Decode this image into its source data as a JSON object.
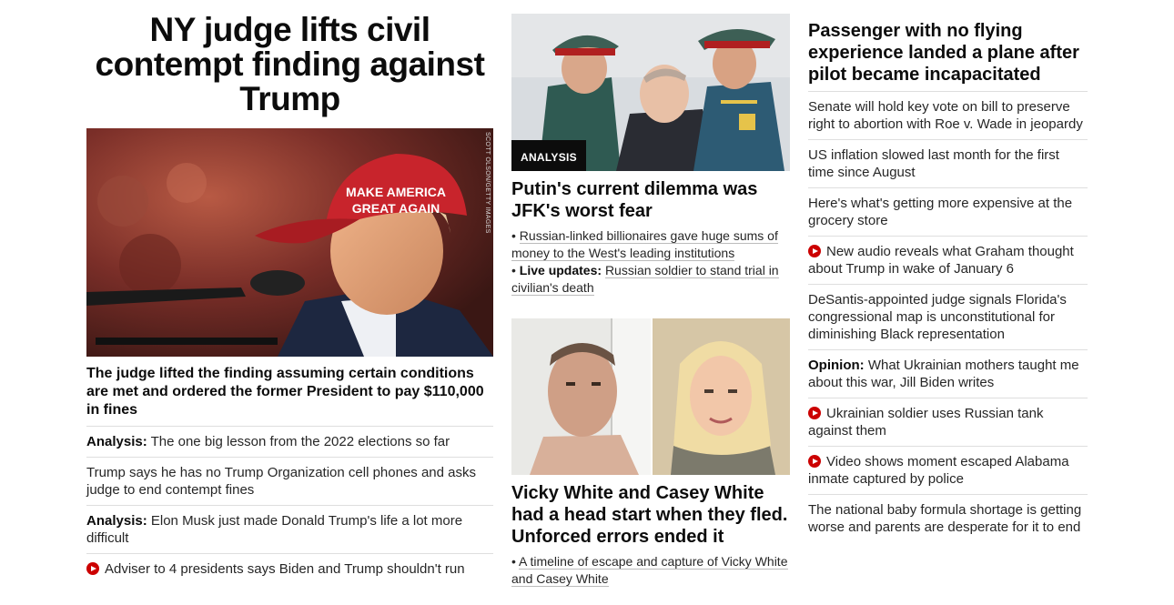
{
  "col1": {
    "headline": "NY judge lifts civil contempt finding against Trump",
    "photo_credit": "SCOTT OLSON/GETTY IMAGES",
    "cap_text": "MAKE AMERICA GREAT AGAIN",
    "subhead": "The judge lifted the finding assuming certain conditions are met and ordered the former President to pay $110,000 in fines",
    "items": [
      {
        "prefix": "Analysis:",
        "text": "The one big lesson from the 2022 elections so far"
      },
      {
        "prefix": "",
        "text": "Trump says he has no Trump Organization cell phones and asks judge to end contempt fines"
      },
      {
        "prefix": "Analysis:",
        "text": "Elon Musk just made Donald Trump's life a lot more difficult"
      },
      {
        "prefix": "",
        "text": "Adviser to 4 presidents says Biden and Trump shouldn't run"
      }
    ]
  },
  "col2": {
    "story1": {
      "tag": "ANALYSIS",
      "headline": "Putin's current dilemma was JFK's worst fear",
      "bullet1": "Russian-linked billionaires gave huge sums of money to the West's leading institutions",
      "bullet2_prefix": "Live updates:",
      "bullet2": "Russian soldier to stand trial in civilian's death"
    },
    "story2": {
      "headline": "Vicky White and Casey White had a head start when they fled. Unforced errors ended it",
      "bullet1": "A timeline of escape and capture of Vicky White and Casey White"
    }
  },
  "col3": {
    "headline": "Passenger with no flying experience landed a plane after pilot became incapacitated",
    "items": [
      {
        "prefix": "",
        "text": "Senate will hold key vote on bill to preserve right to abortion with Roe v. Wade in jeopardy"
      },
      {
        "prefix": "",
        "text": "US inflation slowed last month for the first time since August"
      },
      {
        "prefix": "",
        "text": "Here's what's getting more expensive at the grocery store"
      },
      {
        "prefix": "",
        "text": "New audio reveals what Graham thought about Trump in wake of January 6"
      },
      {
        "prefix": "",
        "text": "DeSantis-appointed judge signals Florida's congressional map is unconstitutional for diminishing Black representation"
      },
      {
        "prefix": "Opinion:",
        "text": "What Ukrainian mothers taught me about this war, Jill Biden writes"
      },
      {
        "prefix": "",
        "text": "Ukrainian soldier uses Russian tank against them"
      },
      {
        "prefix": "",
        "text": "Video shows moment escaped Alabama inmate captured by police"
      },
      {
        "prefix": "",
        "text": "The national baby formula shortage is getting worse and parents are desperate for it to end"
      }
    ]
  },
  "colors": {
    "text": "#0c0c0c",
    "divider": "#dedede",
    "video_red": "#cc0000",
    "tag_bg": "#0c0c0c"
  }
}
